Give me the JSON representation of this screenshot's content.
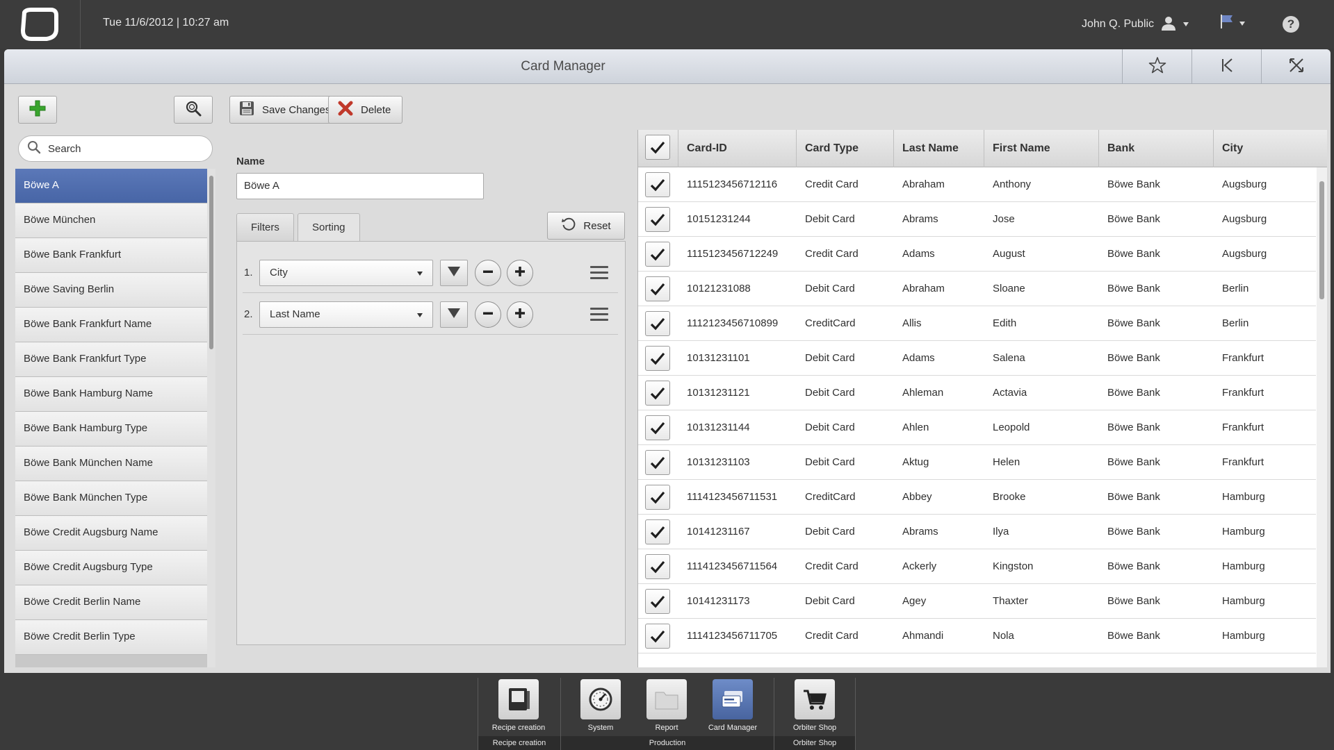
{
  "topbar": {
    "datetime": "Tue 11/6/2012  |  10:27 am",
    "user_name": "John Q. Public"
  },
  "window": {
    "title": "Card Manager"
  },
  "sidebar": {
    "search_placeholder": "Search",
    "items": [
      {
        "label": "Böwe A",
        "selected": true
      },
      {
        "label": "Böwe München"
      },
      {
        "label": "Böwe Bank Frankfurt"
      },
      {
        "label": "Böwe Saving Berlin"
      },
      {
        "label": "Böwe Bank Frankfurt Name"
      },
      {
        "label": "Böwe Bank Frankfurt Type"
      },
      {
        "label": "Böwe Bank Hamburg Name"
      },
      {
        "label": "Böwe Bank Hamburg Type"
      },
      {
        "label": "Böwe Bank München Name"
      },
      {
        "label": "Böwe Bank München Type"
      },
      {
        "label": "Böwe Credit Augsburg Name"
      },
      {
        "label": "Böwe Credit Augsburg Type"
      },
      {
        "label": "Böwe Credit Berlin Name"
      },
      {
        "label": "Böwe Credit Berlin Type"
      }
    ]
  },
  "toolbar": {
    "save_label": "Save Changes",
    "delete_label": "Delete"
  },
  "editor": {
    "name_label": "Name",
    "name_value": "Böwe A",
    "tabs": [
      {
        "label": "Filters"
      },
      {
        "label": "Sorting",
        "active": true
      }
    ],
    "reset_label": "Reset",
    "sort_rows": [
      {
        "num": "1.",
        "field": "City"
      },
      {
        "num": "2.",
        "field": "Last Name"
      }
    ]
  },
  "table": {
    "columns": [
      "Card-ID",
      "Card Type",
      "Last Name",
      "First Name",
      "Bank",
      "City"
    ],
    "rows": [
      [
        "1115123456712116",
        "Credit Card",
        "Abraham",
        "Anthony",
        "Böwe Bank",
        "Augsburg"
      ],
      [
        "10151231244",
        "Debit Card",
        "Abrams",
        "Jose",
        "Böwe Bank",
        "Augsburg"
      ],
      [
        "1115123456712249",
        "Credit Card",
        "Adams",
        "August",
        "Böwe Bank",
        "Augsburg"
      ],
      [
        "10121231088",
        "Debit Card",
        "Abraham",
        "Sloane",
        "Böwe Bank",
        "Berlin"
      ],
      [
        "1112123456710899",
        "CreditCard",
        "Allis",
        "Edith",
        "Böwe Bank",
        "Berlin"
      ],
      [
        "10131231101",
        "Debit Card",
        "Adams",
        "Salena",
        "Böwe Bank",
        "Frankfurt"
      ],
      [
        "10131231121",
        "Debit Card",
        "Ahleman",
        "Actavia",
        "Böwe Bank",
        "Frankfurt"
      ],
      [
        "10131231144",
        "Debit Card",
        "Ahlen",
        "Leopold",
        "Böwe Bank",
        "Frankfurt"
      ],
      [
        "10131231103",
        "Debit Card",
        "Aktug",
        "Helen",
        "Böwe Bank",
        "Frankfurt"
      ],
      [
        "1114123456711531",
        "CreditCard",
        "Abbey",
        "Brooke",
        "Böwe Bank",
        "Hamburg"
      ],
      [
        "10141231167",
        "Debit Card",
        "Abrams",
        "Ilya",
        "Böwe Bank",
        "Hamburg"
      ],
      [
        "1114123456711564",
        "Credit Card",
        "Ackerly",
        "Kingston",
        "Böwe Bank",
        "Hamburg"
      ],
      [
        "10141231173",
        "Debit Card",
        "Agey",
        "Thaxter",
        "Böwe Bank",
        "Hamburg"
      ],
      [
        "1114123456711705",
        "Credit Card",
        "Ahmandi",
        "Nola",
        "Böwe Bank",
        "Hamburg"
      ]
    ]
  },
  "dock": {
    "apps": [
      {
        "label": "Recipe creation",
        "icon": "book-icon"
      },
      {
        "label": "System",
        "icon": "gauge-icon"
      },
      {
        "label": "Report",
        "icon": "folder-icon"
      },
      {
        "label": "Card Manager",
        "icon": "cards-icon",
        "active": true
      },
      {
        "label": "Orbiter Shop",
        "icon": "cart-icon"
      }
    ],
    "groups": [
      {
        "label": "Recipe creation"
      },
      {
        "label": "Production"
      },
      {
        "label": "Orbiter Shop"
      }
    ]
  },
  "colors": {
    "selected_blue": "#4f6cae",
    "topbar_bg": "#3c3c3c",
    "delete_red": "#c0392b",
    "add_green": "#3aa52e"
  }
}
